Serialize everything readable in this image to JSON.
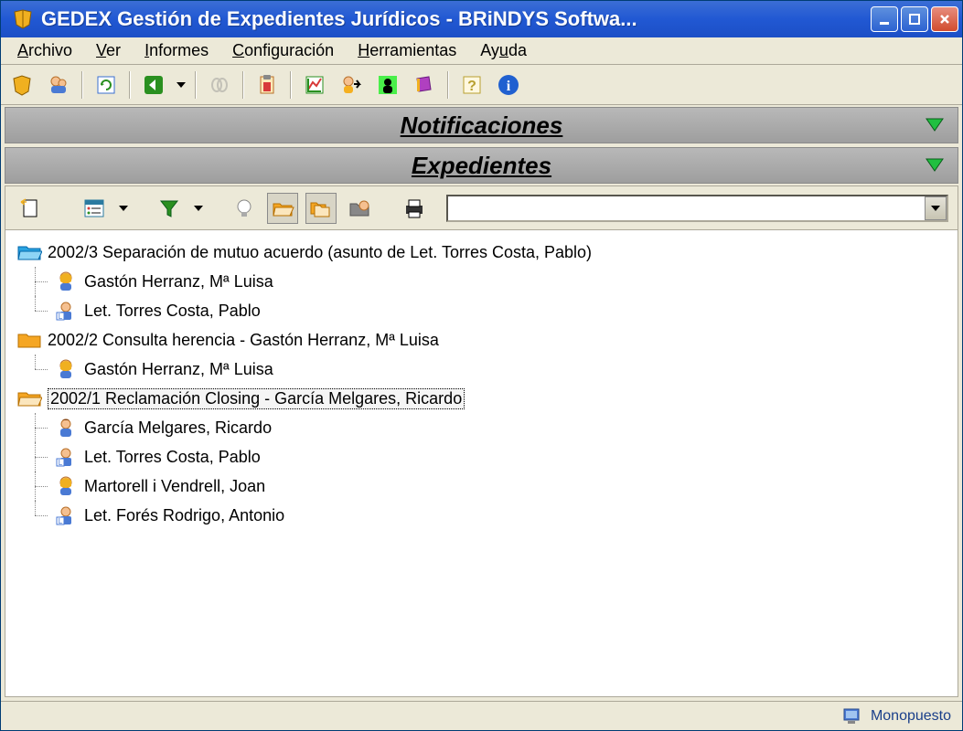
{
  "title": "GEDEX Gestión de Expedientes Jurídicos - BRiNDYS Softwa...",
  "menu": {
    "archivo": "Archivo",
    "ver": "Ver",
    "informes": "Informes",
    "configuracion": "Configuración",
    "herramientas": "Herramientas",
    "ayuda": "Ayuda"
  },
  "sections": {
    "notificaciones": "Notificaciones",
    "expedientes": "Expedientes"
  },
  "tree": {
    "n0": "2002/3 Separación de mutuo acuerdo  (asunto de Let. Torres Costa, Pablo)",
    "n0c0": "Gastón Herranz, Mª Luisa",
    "n0c1": "Let. Torres Costa, Pablo",
    "n1": "2002/2 Consulta herencia  - Gastón Herranz, Mª Luisa",
    "n1c0": "Gastón Herranz, Mª Luisa",
    "n2": "2002/1 Reclamación Closing  - García Melgares, Ricardo",
    "n2c0": "García Melgares, Ricardo",
    "n2c1": "Let. Torres Costa, Pablo",
    "n2c2": "Martorell i Vendrell, Joan",
    "n2c3": "Let. Forés Rodrigo, Antonio"
  },
  "status": "Monopuesto",
  "combo_value": ""
}
